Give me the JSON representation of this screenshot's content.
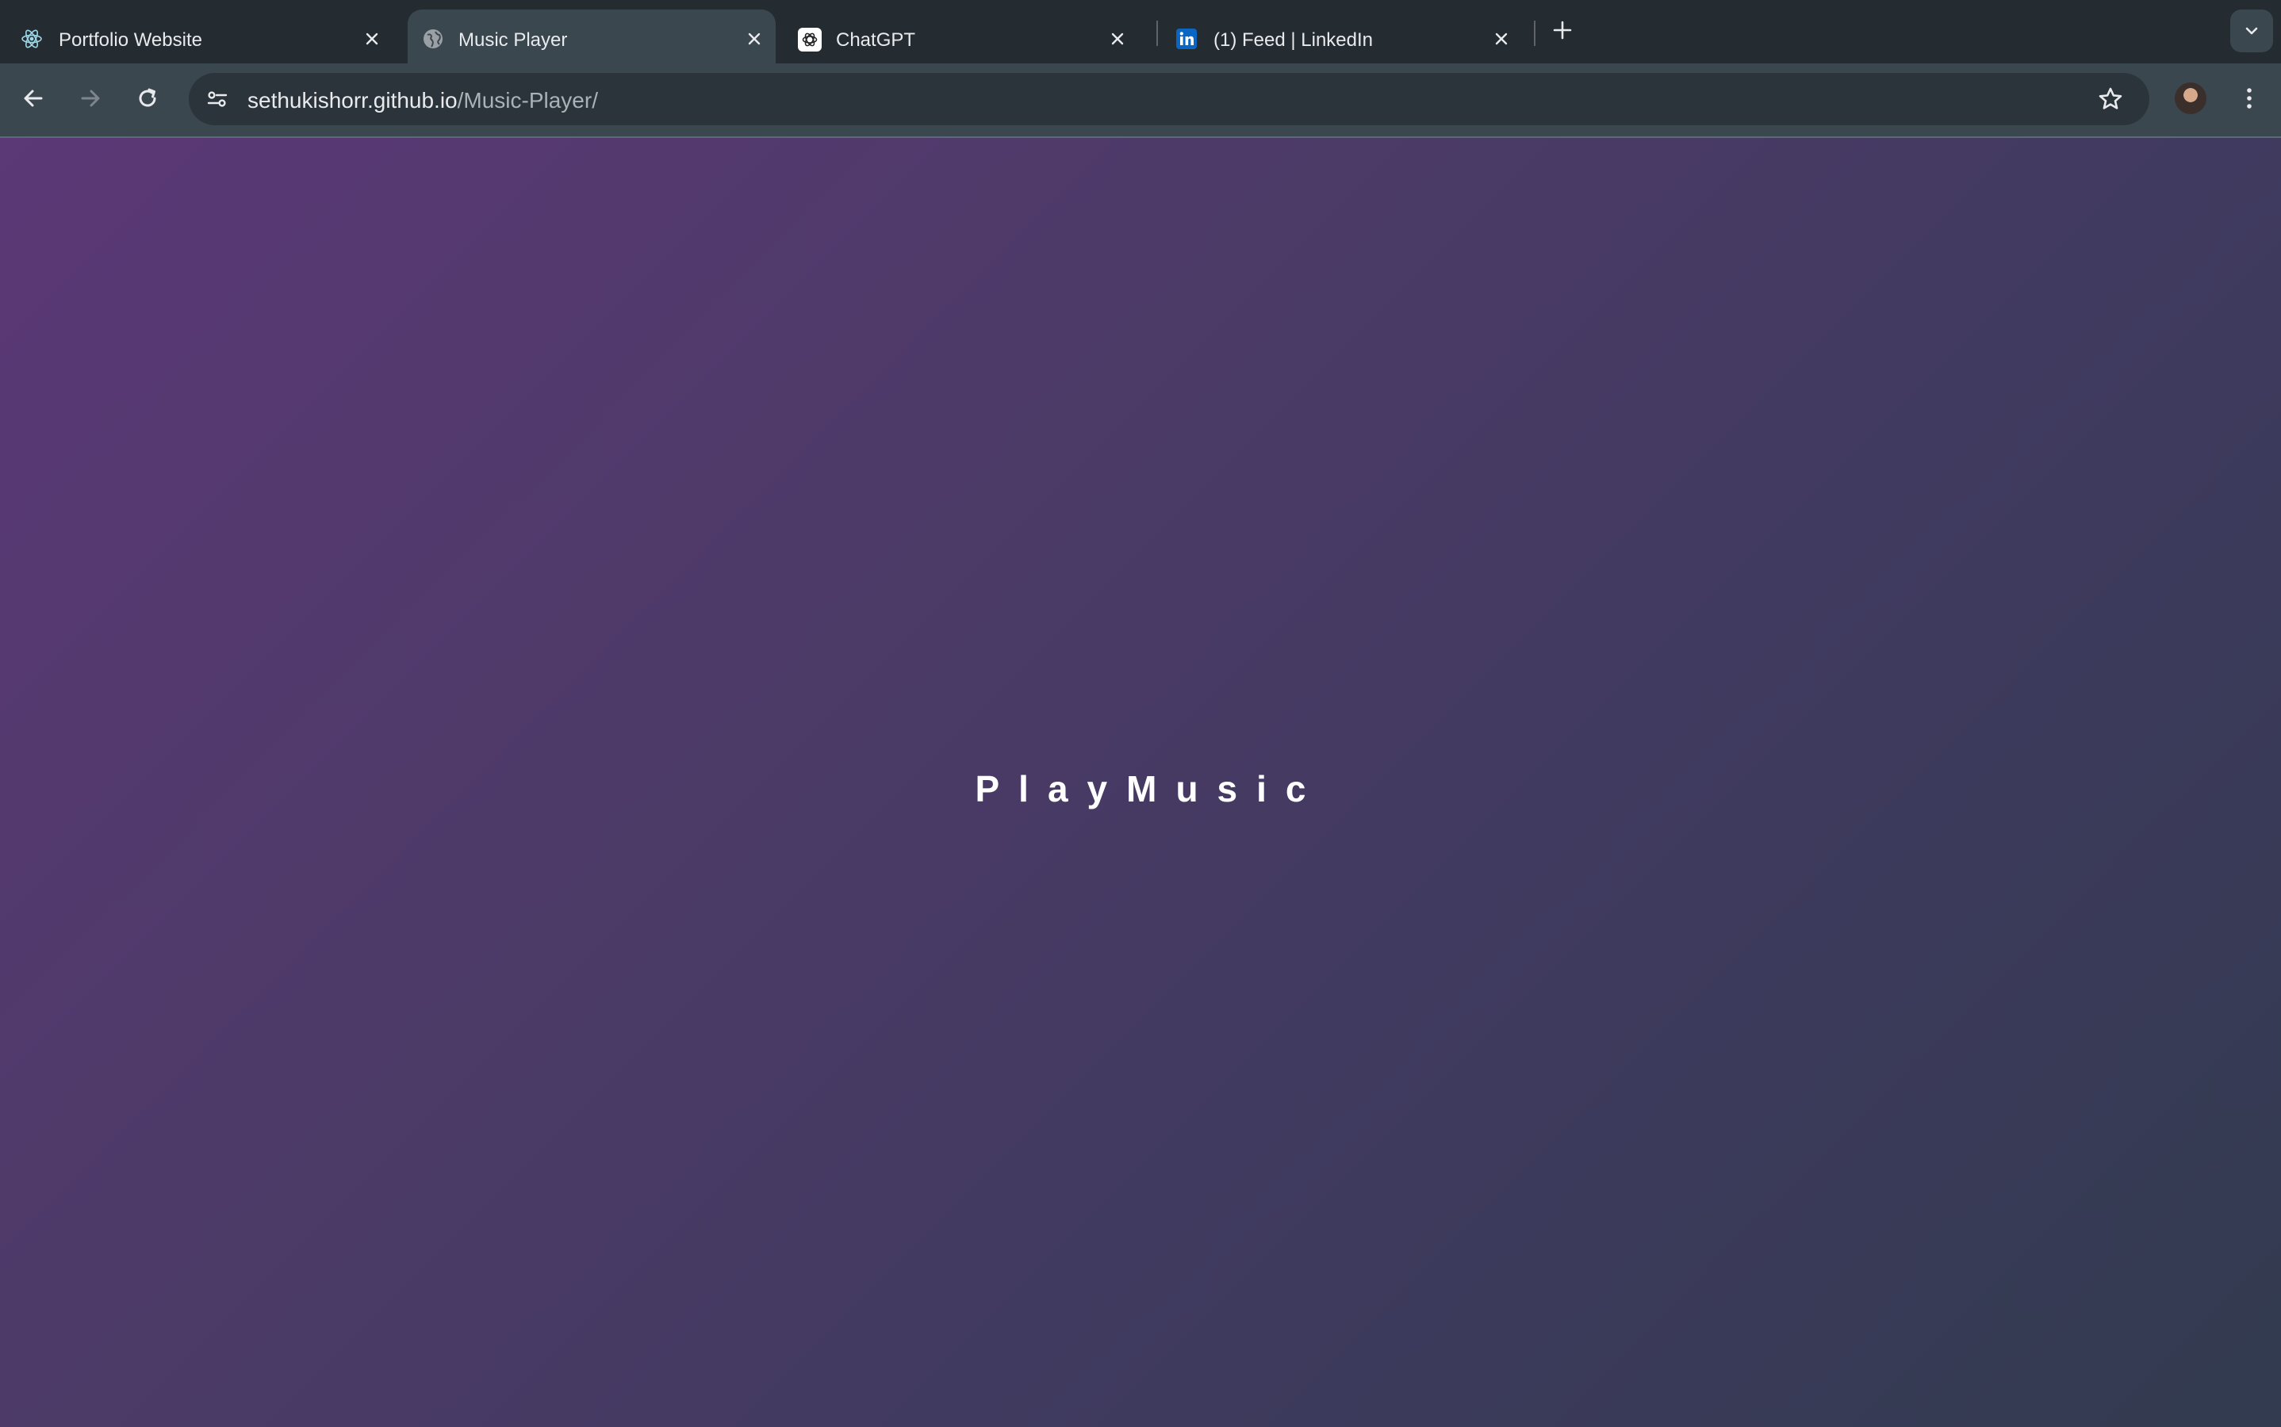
{
  "browser": {
    "tabs": [
      {
        "title": "Portfolio Website",
        "favicon": "react-icon",
        "active": false
      },
      {
        "title": "Music Player",
        "favicon": "globe-icon",
        "active": true
      },
      {
        "title": "ChatGPT",
        "favicon": "chatgpt-icon",
        "active": false
      },
      {
        "title": "(1) Feed | LinkedIn",
        "favicon": "linkedin-icon",
        "active": false
      }
    ],
    "url": {
      "host": "sethukishorr.github.io",
      "path": "/Music-Player/"
    },
    "colors": {
      "tabbar": "#252c31",
      "toolbar": "#3a474e",
      "omnibox": "#2b343a"
    }
  },
  "page": {
    "title": "PlayMusic",
    "colors": {
      "gradient_start": "#5b3876",
      "gradient_end": "#323b4f",
      "title": "#ffffff"
    }
  }
}
